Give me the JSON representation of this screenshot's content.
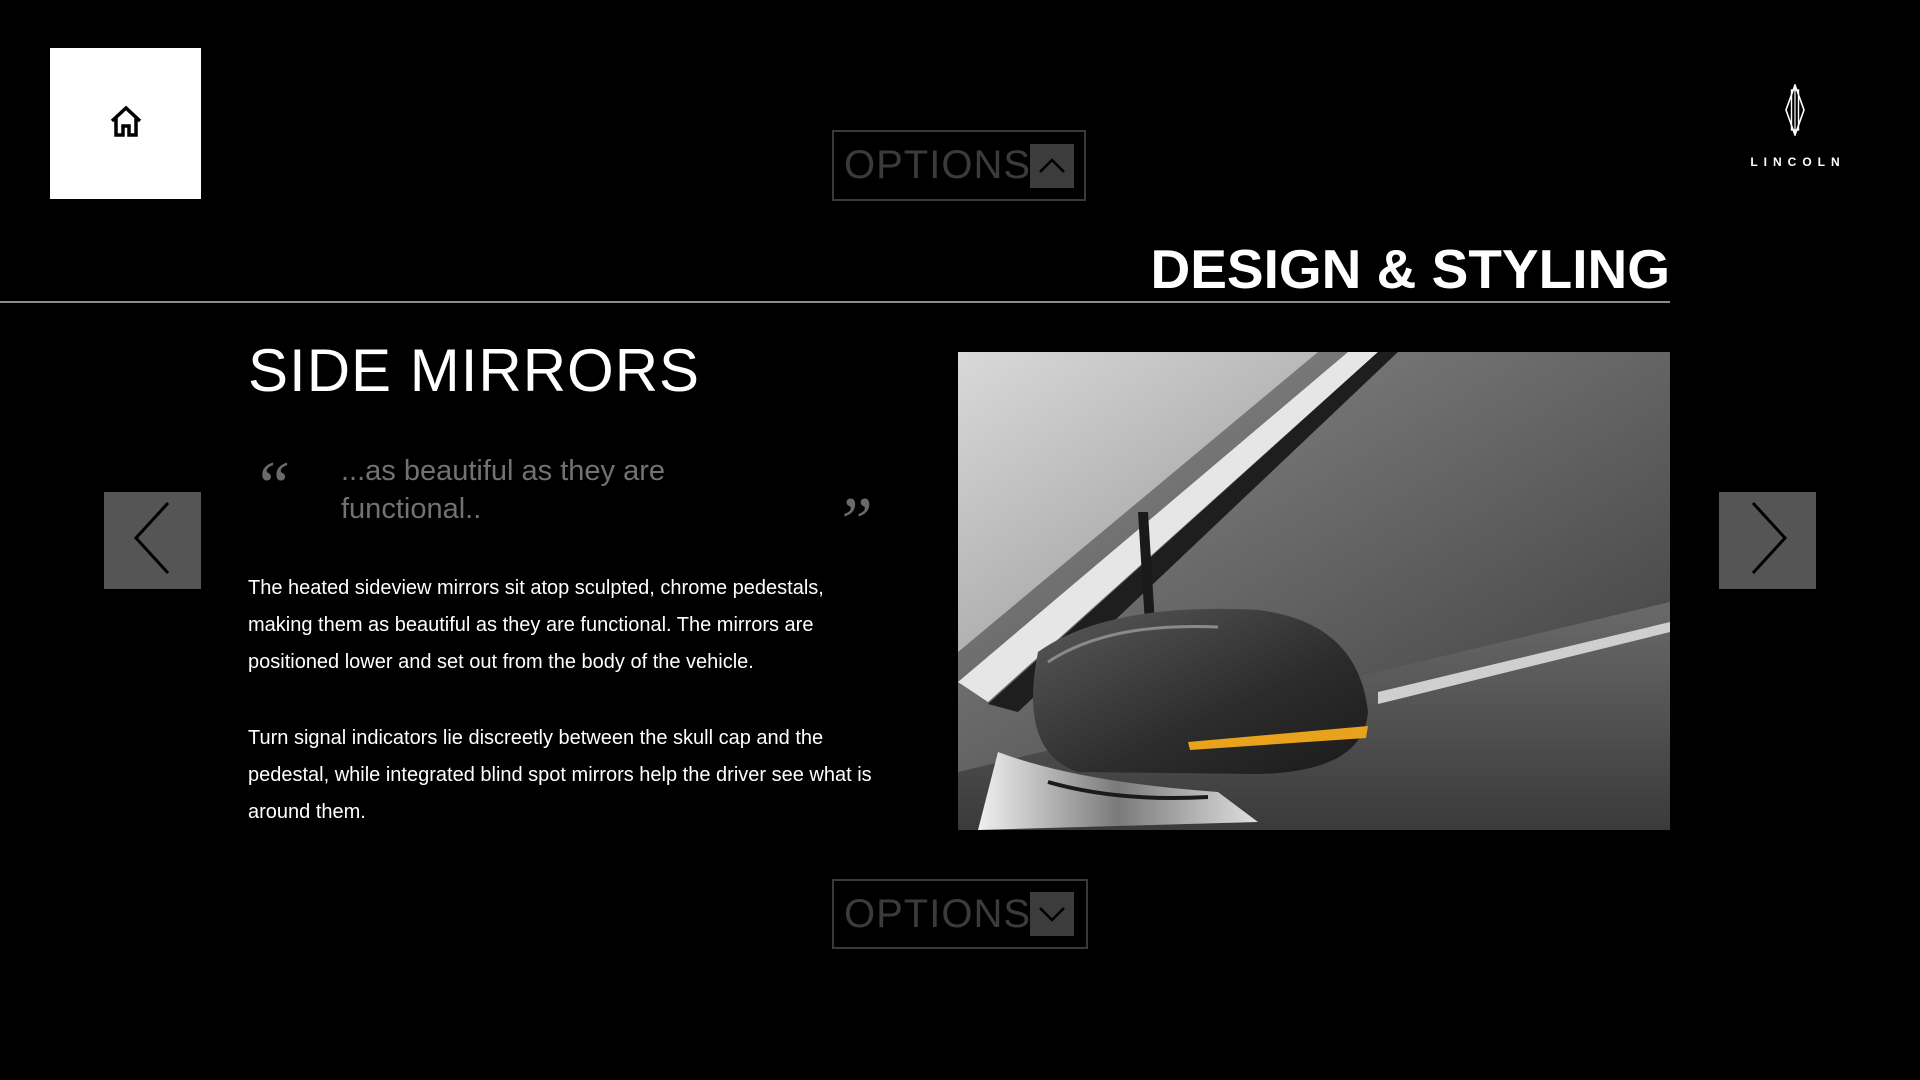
{
  "nav": {
    "home_icon": "home-icon",
    "prev_icon": "chevron-left-icon",
    "next_icon": "chevron-right-icon"
  },
  "brand": {
    "name": "LINCOLN",
    "logo_icon": "lincoln-star-icon"
  },
  "options_top": {
    "label": "OPTIONS",
    "icon": "chevron-up-icon"
  },
  "options_bottom": {
    "label": "OPTIONS",
    "icon": "chevron-down-icon"
  },
  "section": {
    "title": "DESIGN & STYLING"
  },
  "feature": {
    "title": "SIDE MIRRORS",
    "quote_open": "“",
    "quote_close": "”",
    "quote": "...as beautiful as they are functional..",
    "paragraph_1": "The heated sideview mirrors sit atop sculpted, chrome pedestals, making them as beautiful as they are functional. The mirrors are positioned lower and set out from the body of the vehicle.",
    "paragraph_2": "Turn signal indicators lie discreetly between the skull cap and the pedestal, while integrated blind spot mirrors help the driver see what is around them."
  },
  "colors": {
    "background": "#000000",
    "button_gray": "#555555",
    "options_border": "#3a3a3a",
    "options_text": "#3b3b3b",
    "quote_text": "#727272",
    "turn_signal": "#e8a21c"
  }
}
